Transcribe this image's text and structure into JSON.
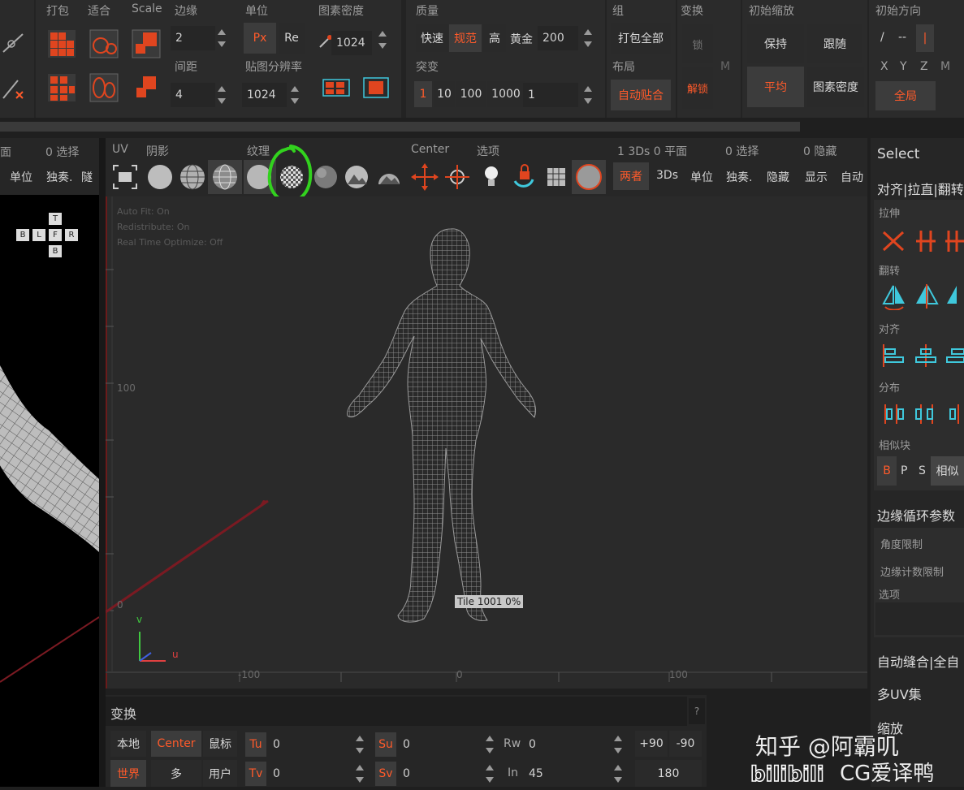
{
  "toolbar": {
    "pack_label": "打包",
    "fit_label": "适合",
    "scale_label": "Scale",
    "edge_label": "边缘",
    "edge_value": "2",
    "spacing_label": "间距",
    "spacing_value": "4",
    "unit_label": "单位",
    "unit_px": "Px",
    "unit_re": "Re",
    "texel_label": "图素密度",
    "texel_value": "1024",
    "map_res_label": "贴图分辨率",
    "map_res_value": "1024",
    "quality_label": "质量",
    "quality_fast": "快速",
    "quality_normal": "规范",
    "quality_high": "高",
    "quality_gold": "黄金",
    "quality_value": "200",
    "mutate_label": "突变",
    "mutate_1": "1",
    "mutate_10": "10",
    "mutate_100": "100",
    "mutate_1000": "1000",
    "mutate_value": "1",
    "group_label": "组",
    "pack_all": "打包全部",
    "layout_label": "布局",
    "auto_fit": "自动贴合",
    "transform_label": "变换",
    "lock": "锁",
    "unlock": "解锁",
    "m_label": "M",
    "init_scale_label": "初始缩放",
    "keep": "保持",
    "follow": "跟随",
    "average": "平均",
    "texel_density_btn": "图素密度",
    "init_dir_label": "初始方向",
    "dir_slash": "/",
    "dir_dash": "--",
    "dir_bar": "|",
    "dir_x": "X",
    "dir_y": "Y",
    "dir_z": "Z",
    "dir_m": "M",
    "global": "全局"
  },
  "left_panel": {
    "face": "面",
    "selected": "0 选择",
    "unit": "单位",
    "solo": "独奏.",
    "hide_trunc": "隧",
    "cube": {
      "t": "T",
      "b": "B",
      "l": "L",
      "f": "F",
      "r": "R",
      "b2": "B"
    }
  },
  "uv_header": {
    "uv": "UV",
    "shade": "阴影",
    "texture": "纹理",
    "center": "Center",
    "options": "选项",
    "stats_3ds": "1 3Ds 0 平面",
    "stats_sel": "0 选择",
    "stats_hidden": "0 隐藏",
    "both": "两者",
    "3ds": "3Ds",
    "unit": "单位",
    "solo": "独奏.",
    "hide": "隐藏",
    "show": "显示",
    "auto": "自动"
  },
  "viewport": {
    "info_auto_fit": "Auto Fit: On",
    "info_redistribute": "Redistribute: On",
    "info_rto": "Real Time Optimize: Off",
    "tick_100": "100",
    "tick_0": "0",
    "tick_neg100": "-100",
    "tick_0x": "0",
    "tick_100x": "100",
    "axis_v": "v",
    "axis_u": "u",
    "tile_label": "Tile 1001 0%"
  },
  "right_panel": {
    "title": "Select",
    "tabs": "对齐|拉直|翻转",
    "stretch": "拉伸",
    "flip": "翻转",
    "align": "对齐",
    "distribute": "分布",
    "similar_block": "相似块",
    "b": "B",
    "p": "P",
    "s": "S",
    "similar": "相似",
    "edge_loop": "边缘循环参数",
    "angle_limit": "角度限制",
    "edge_count": "边缘计数限制",
    "options": "选项",
    "auto_seam": "自动缝合|全自",
    "multi_uv": "多UV集",
    "zoom": "缩放"
  },
  "transform_panel": {
    "title": "变换",
    "help": "?",
    "local": "本地",
    "center": "Center",
    "mouse": "鼠标",
    "world": "世界",
    "multi": "多",
    "user": "用户",
    "tu": "Tu",
    "tu_val": "0",
    "tv": "Tv",
    "tv_val": "0",
    "su": "Su",
    "su_val": "0",
    "sv": "Sv",
    "sv_val": "0",
    "rw": "Rw",
    "rw_val": "0",
    "in": "In",
    "in_val": "45",
    "p90": "+90",
    "m90": "-90",
    "r180": "180"
  },
  "watermark": {
    "zhihu": "知乎 @阿霸叽",
    "bili": "CG爱译鸭"
  },
  "colors": {
    "accent": "#e0451f",
    "highlight_ring": "#32d21e",
    "cyan": "#3fc8dc"
  }
}
